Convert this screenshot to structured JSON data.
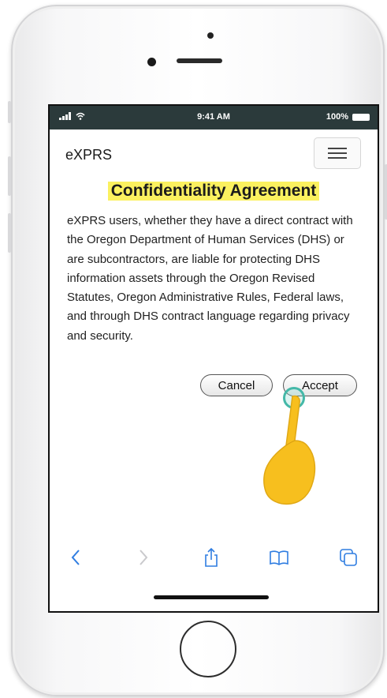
{
  "status_bar": {
    "time": "9:41 AM",
    "battery": "100%"
  },
  "app": {
    "title": "eXPRS"
  },
  "agreement": {
    "heading": "Confidentiality Agreement",
    "body": "eXPRS users, whether they have a direct contract with the Oregon Department of Human Services (DHS) or are subcontractors, are liable for protecting DHS information assets through the Oregon Revised Statutes, Oregon Administrative Rules, Federal laws, and through DHS contract language regarding privacy and security.",
    "cancel_label": "Cancel",
    "accept_label": "Accept"
  },
  "colors": {
    "highlight": "#fbf15f",
    "toolbar_icon": "#2f7de1",
    "hand": "#f7bf1e",
    "tap_ring": "#44b8a8"
  },
  "toolbar": {
    "icons": [
      "back-icon",
      "forward-icon",
      "share-icon",
      "bookmarks-icon",
      "tabs-icon"
    ]
  }
}
